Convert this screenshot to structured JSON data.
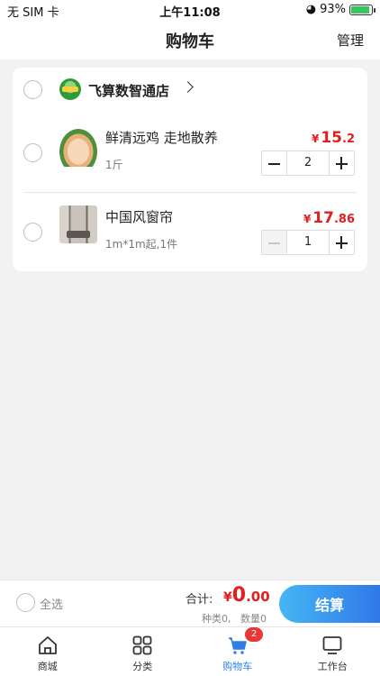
{
  "status": {
    "carrier": "无 SIM 卡",
    "time": "上午11:08",
    "battery": "93%",
    "battery_level": 0.93
  },
  "nav": {
    "title": "购物车",
    "manage": "管理"
  },
  "shop": {
    "name": "飞算数智通店"
  },
  "items": [
    {
      "name": "鲜清远鸡 走地散养",
      "spec": "1斤",
      "currency": "¥",
      "price_int": "15",
      "price_dec": ".2",
      "qty": "2",
      "thumb_icon": "chicken-thumb"
    },
    {
      "name": "中国风窗帘",
      "spec": "1m*1m起,1件",
      "currency": "¥",
      "price_int": "17",
      "price_dec": ".86",
      "qty": "1",
      "thumb_icon": "curtain-thumb"
    }
  ],
  "footer": {
    "select_all": "全选",
    "total_label": "合计:",
    "currency": "¥",
    "total_int": "0",
    "total_dec": ".00",
    "kinds": "种类0,",
    "quantity": "数量0",
    "checkout": "结算"
  },
  "tabs": [
    {
      "label": "商城",
      "icon": "home-icon"
    },
    {
      "label": "分类",
      "icon": "grid-icon"
    },
    {
      "label": "购物车",
      "icon": "cart-icon",
      "badge": "2"
    },
    {
      "label": "工作台",
      "icon": "monitor-icon"
    }
  ],
  "colors": {
    "accent": "#2f7ee8",
    "price": "#e02020",
    "badge": "#e63838"
  }
}
